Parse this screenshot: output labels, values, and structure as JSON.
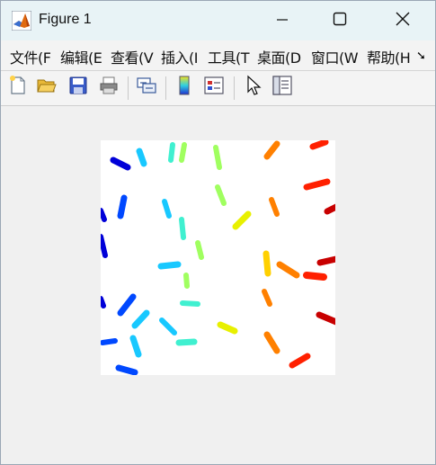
{
  "window": {
    "title": "Figure 1"
  },
  "titlebar_buttons": {
    "minimize_icon": "minimize-icon",
    "maximize_icon": "maximize-icon",
    "close_icon": "close-icon"
  },
  "menu": {
    "items": [
      "文件(F",
      "编辑(E",
      "查看(V",
      "插入(I",
      "工具(T",
      "桌面(D",
      "窗口(W",
      "帮助(H"
    ],
    "overflow_icon": "overflow-arrow-icon",
    "overflow_glyph": "➘"
  },
  "toolbar": {
    "tools": [
      "new-figure-icon",
      "open-file-icon",
      "save-icon",
      "print-icon",
      "link-plot-icon",
      "colorbar-icon",
      "legend-icon",
      "pointer-icon",
      "property-inspector-icon"
    ]
  },
  "image": {
    "description_colormap": "jet",
    "colors": {
      "darkblue": "#0000d8",
      "blue": "#0048ff",
      "cyan": "#18c8ff",
      "aqua": "#40f0d0",
      "lime": "#a0ff60",
      "yellow": "#e8f000",
      "gold": "#ffd000",
      "orange": "#ff8000",
      "red": "#ff2000",
      "darkred": "#c80000"
    }
  }
}
